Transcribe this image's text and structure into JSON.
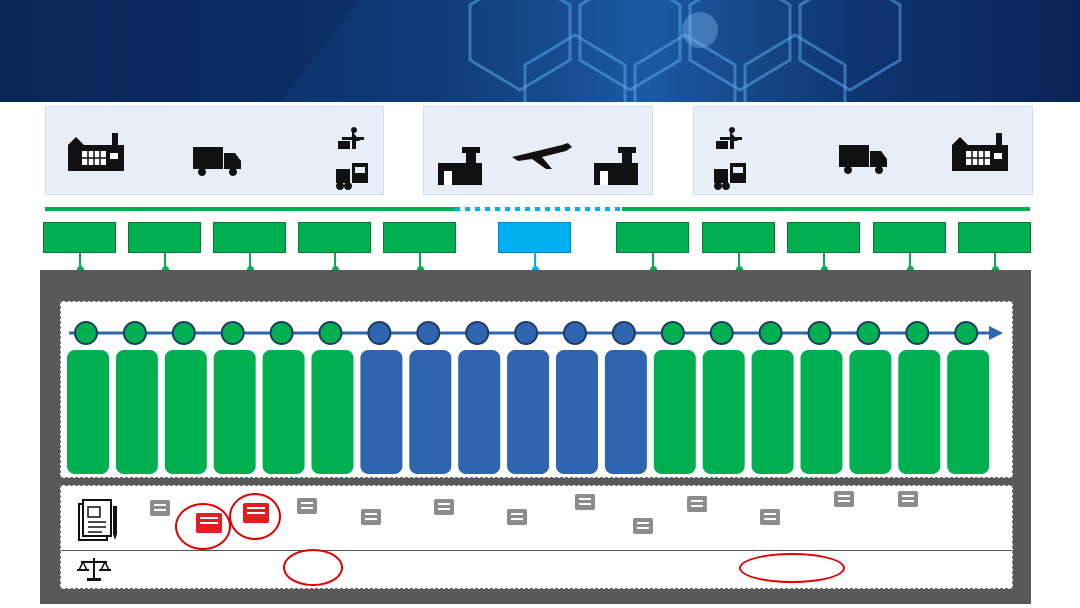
{
  "colors": {
    "green": "#00b050",
    "blue_stage": "#00b0f0",
    "blue_column": "#2e64b0",
    "frame": "#595959",
    "panel": "#e8eef8",
    "highlight": "#e00000"
  },
  "panels": [
    {
      "icons": [
        "factory-icon",
        "truck-icon",
        "customs-inspection-icon",
        "forklift-icon"
      ]
    },
    {
      "icons": [
        "airport-icon",
        "airplane-icon",
        "airport-icon"
      ]
    },
    {
      "icons": [
        "customs-inspection-icon",
        "forklift-icon",
        "truck-icon",
        "factory-icon"
      ]
    }
  ],
  "stages": [
    {
      "kind": "green"
    },
    {
      "kind": "green"
    },
    {
      "kind": "green"
    },
    {
      "kind": "green"
    },
    {
      "kind": "green"
    },
    {
      "kind": "blue"
    },
    {
      "kind": "green"
    },
    {
      "kind": "green"
    },
    {
      "kind": "green"
    },
    {
      "kind": "green"
    },
    {
      "kind": "green"
    }
  ],
  "process_steps": [
    "green",
    "green",
    "green",
    "green",
    "green",
    "green",
    "blue",
    "blue",
    "blue",
    "blue",
    "blue",
    "blue",
    "green",
    "green",
    "green",
    "green",
    "green",
    "green",
    "green"
  ],
  "documents": {
    "total": 14,
    "highlighted": 2,
    "icons": [
      "documents-icon",
      "law-scale-icon"
    ]
  }
}
